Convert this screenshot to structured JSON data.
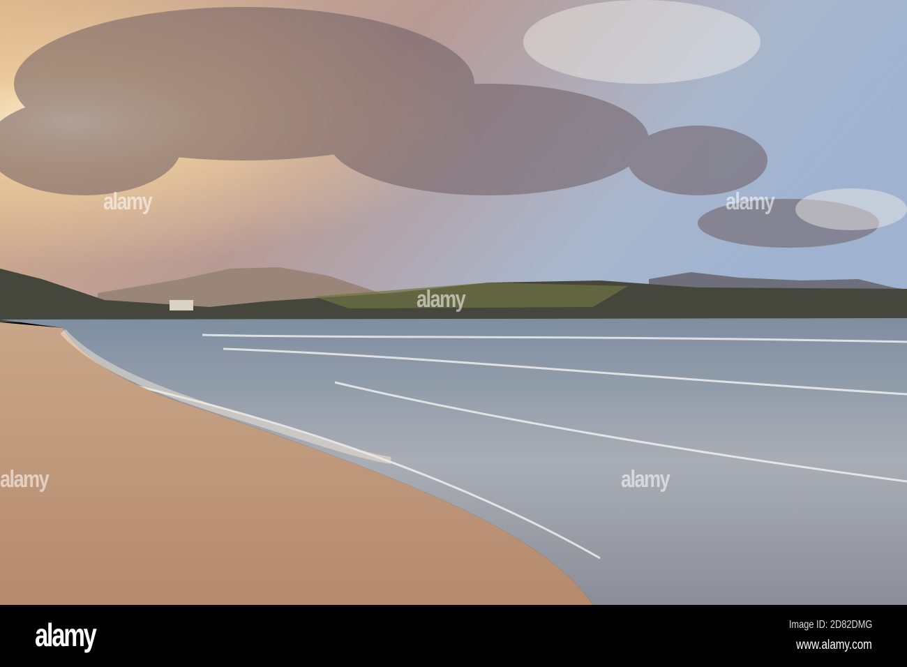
{
  "watermark": "alamy",
  "footer": {
    "logo": "alamy",
    "image_id": "Image ID: 2D82DMG",
    "website": "www.alamy.com"
  }
}
